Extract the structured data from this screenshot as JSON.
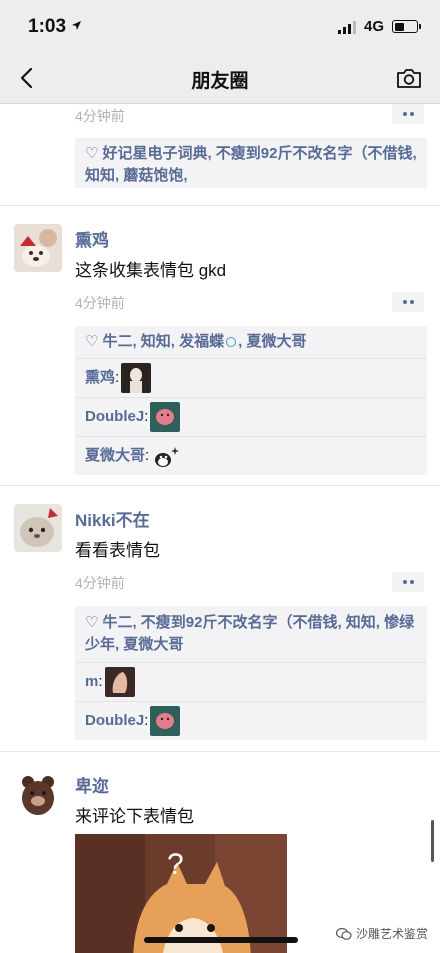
{
  "status_bar": {
    "time": "1:03",
    "network": "4G"
  },
  "nav": {
    "title": "朋友圈"
  },
  "posts": [
    {
      "time": "4分钟前",
      "likes": "好记星电子词典, 不瘦到92斤不改名字（不借钱, 知知, 蘑菇饱饱,"
    },
    {
      "name": "熏鸡",
      "text": "这条收集表情包 gkd",
      "time": "4分钟前",
      "likes_a": "牛二, 知知, 发福蝶",
      "likes_b": ", 夏微大哥",
      "comments": [
        {
          "author": "熏鸡",
          "colon": ":"
        },
        {
          "author": "DoubleJ",
          "colon": ":"
        },
        {
          "author": "夏微大哥",
          "colon": ":"
        }
      ]
    },
    {
      "name": "Nikki不在",
      "text": "看看表情包",
      "time": "4分钟前",
      "likes": "牛二, 不瘦到92斤不改名字（不借钱, 知知, 惨绿少年, 夏微大哥",
      "comments": [
        {
          "author": "m",
          "colon": ":"
        },
        {
          "author": "DoubleJ",
          "colon": ":"
        }
      ]
    },
    {
      "name": "卑迩",
      "text": "来评论下表情包"
    }
  ],
  "watermark": "沙雕艺术鉴赏",
  "icons": {
    "back": "back-arrow-icon",
    "camera": "camera-icon",
    "heart": "heart-icon",
    "more": "more-dots-icon"
  },
  "colors": {
    "link": "#576b95",
    "background": "#ededed",
    "panel": "#f3f3f5"
  }
}
